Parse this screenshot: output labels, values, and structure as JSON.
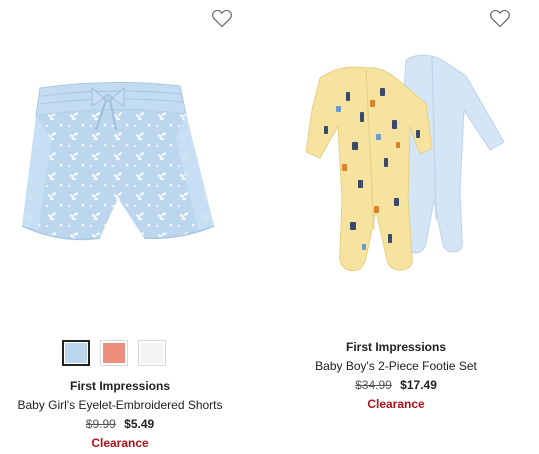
{
  "products": [
    {
      "brand": "First Impressions",
      "name": "Baby Girl's Eyelet-Embroidered Shorts",
      "original_price": "$9.99",
      "sale_price": "$5.49",
      "badge": "Clearance",
      "wishlist_icon": "heart-outline-icon",
      "swatches": [
        {
          "color": "#bcd6ee",
          "selected": true
        },
        {
          "color": "#ee8e7c",
          "selected": false
        },
        {
          "color": "#f3f3f3",
          "selected": false
        }
      ]
    },
    {
      "brand": "First Impressions",
      "name": "Baby Boy's 2-Piece Footie Set",
      "original_price": "$34.99",
      "sale_price": "$17.49",
      "badge": "Clearance",
      "wishlist_icon": "heart-outline-icon"
    }
  ],
  "colors": {
    "clearance": "#b0121b",
    "text": "#222222"
  }
}
